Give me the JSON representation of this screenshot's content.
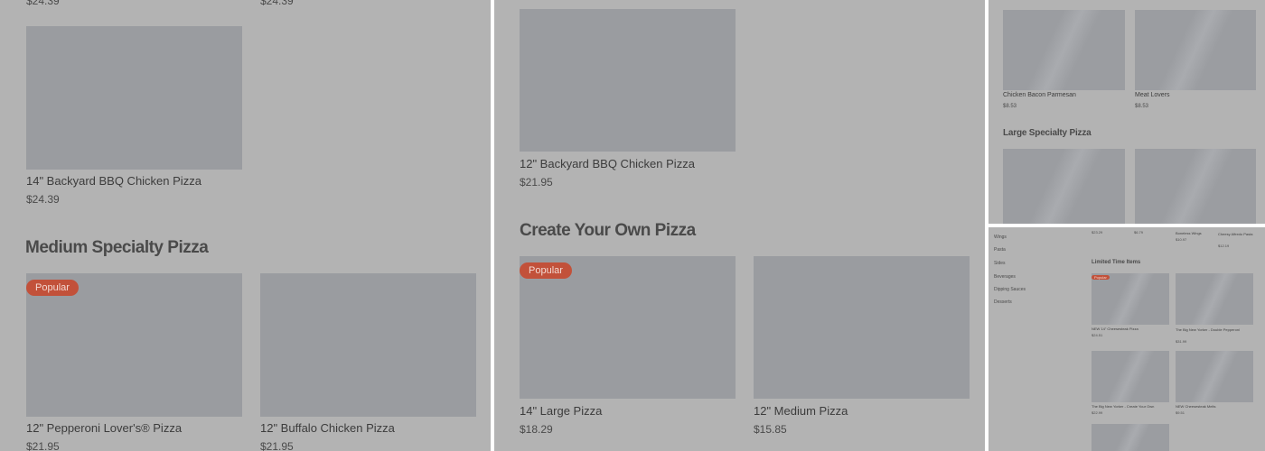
{
  "panel1": {
    "top_prices": [
      "$24.39",
      "$24.39"
    ],
    "bbq_card": {
      "name": "14\" Backyard BBQ Chicken Pizza",
      "price": "$24.39"
    },
    "section_title": "Medium Specialty Pizza",
    "cards": [
      {
        "name": "12\" Pepperoni Lover's® Pizza",
        "price": "$21.95",
        "badge": "Popular"
      },
      {
        "name": "12\" Buffalo Chicken Pizza",
        "price": "$21.95"
      }
    ]
  },
  "panel2": {
    "bbq_card": {
      "name": "12\" Backyard BBQ Chicken Pizza",
      "price": "$21.95"
    },
    "section_title": "Create Your Own Pizza",
    "cards": [
      {
        "name": "14\" Large Pizza",
        "price": "$18.29",
        "badge": "Popular"
      },
      {
        "name": "12\" Medium Pizza",
        "price": "$15.85"
      }
    ]
  },
  "panel3": {
    "cards": [
      {
        "name": "Chicken Bacon Parmesan",
        "price": "$8.53"
      },
      {
        "name": "Meat Lovers",
        "price": "$8.53"
      }
    ],
    "section_title": "Large Specialty Pizza"
  },
  "panel4": {
    "sidebar": [
      "Wings",
      "Pasta",
      "Sides",
      "Beverages",
      "Dipping Sauces",
      "Desserts"
    ],
    "top_strip": [
      {
        "name": "",
        "price": "$23.29"
      },
      {
        "name": "",
        "price": "$6.79"
      },
      {
        "name": "Boneless Wings",
        "price": "$10.97"
      },
      {
        "name": "Cheesy Alfredo Pasta",
        "price": "$12.19"
      }
    ],
    "section_title": "Limited Time Items",
    "cards": [
      {
        "name": "NEW 14\" Cheesesteak Pizza",
        "price": "$24.51",
        "badge": "Popular"
      },
      {
        "name": "The Big New Yorker - Double Pepperoni",
        "price": "$31.99"
      },
      {
        "name": "The Big New Yorker - Create Your Own",
        "price": "$22.99"
      },
      {
        "name": "NEW Cheesesteak Melts",
        "price": "$9.51"
      }
    ]
  }
}
